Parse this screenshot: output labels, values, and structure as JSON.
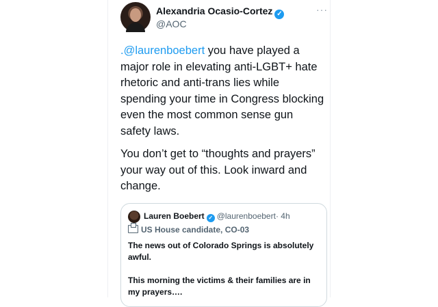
{
  "tweet": {
    "author_name": "Alexandria Ocasio-Cortez",
    "author_handle": "@AOC",
    "more_label": "···",
    "mention": ".@laurenboebert",
    "paragraph1_rest": " you have played a major role in elevating anti-LGBT+ hate rhetoric and anti-trans lies while spending your time in Congress blocking even the most common sense gun safety laws.",
    "paragraph2": "You don’t get to “thoughts and prayers” your way out of this. Look inward and change."
  },
  "quoted_tweet": {
    "author_name": "Lauren Boebert",
    "author_handle": "@laurenboebert",
    "time": "· 4h",
    "label": "US House candidate, CO-03",
    "paragraph1": "The news out of Colorado Springs is absolutely awful.",
    "paragraph2": "This morning the victims & their families are in my prayers…."
  },
  "colors": {
    "link": "#1d9bf0",
    "verified": "#1d9bf0",
    "text": "#0f1419",
    "secondary": "#536471"
  },
  "icons": {
    "verified": "✓"
  }
}
